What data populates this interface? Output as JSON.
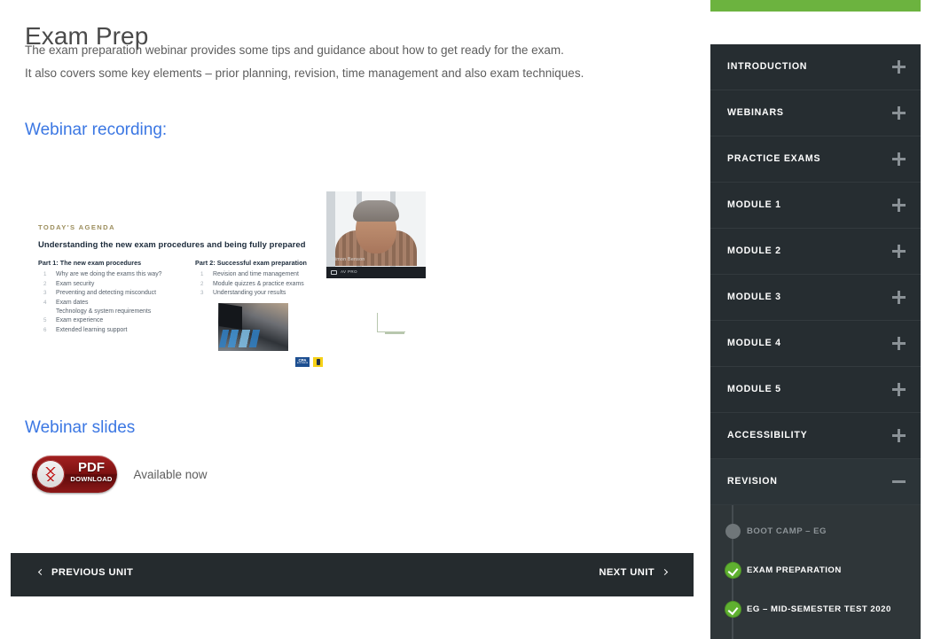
{
  "main": {
    "title": "Exam Prep",
    "paragraph_1": "The exam preparation webinar provides some tips and guidance about how to get ready for the exam.",
    "paragraph_2": "It also covers some key elements – prior planning, revision, time management and also exam techniques.",
    "section_recording": "Webinar recording:",
    "section_slides": "Webinar slides"
  },
  "slide": {
    "watermark_top_left": "",
    "watermark_bottom_right": "",
    "kicker": "TODAY'S AGENDA",
    "title": "Understanding the new exam procedures and being fully prepared",
    "part1_heading": "Part 1: The new exam procedures",
    "part1_items": [
      {
        "num": "1",
        "text": "Why are we doing the exams this way?"
      },
      {
        "num": "2",
        "text": "Exam security"
      },
      {
        "num": "3",
        "text": "Preventing and detecting misconduct"
      },
      {
        "num": "4",
        "text": "Exam dates"
      },
      {
        "num": "",
        "text": "Technology & system requirements"
      },
      {
        "num": "5",
        "text": "Exam experience"
      },
      {
        "num": "6",
        "text": "Extended learning support"
      }
    ],
    "part2_heading": "Part 2: Successful exam preparation",
    "part2_items": [
      {
        "num": "1",
        "text": "Revision and time management"
      },
      {
        "num": "2",
        "text": "Module quizzes & practice exams"
      },
      {
        "num": "3",
        "text": "Understanding your results"
      }
    ],
    "logo_primary": "CPA",
    "logo_primary_sub": "AUSTRALIA",
    "webcam_name": "Simon Benson",
    "webcam_status": "AV PRO"
  },
  "download": {
    "button_main": "PDF",
    "button_sub": "DOWNLOAD",
    "availability": "Available now"
  },
  "unit_nav": {
    "previous": "PREVIOUS UNIT",
    "next": "NEXT UNIT"
  },
  "sidebar": {
    "accent_color": "#6cb33f",
    "background_color": "#262d31",
    "items": [
      {
        "label": "INTRODUCTION",
        "state": "collapsed",
        "icon": "plus-icon"
      },
      {
        "label": "WEBINARS",
        "state": "collapsed",
        "icon": "plus-icon"
      },
      {
        "label": "PRACTICE EXAMS",
        "state": "collapsed",
        "icon": "plus-icon"
      },
      {
        "label": "MODULE 1",
        "state": "collapsed",
        "icon": "plus-icon"
      },
      {
        "label": "MODULE 2",
        "state": "collapsed",
        "icon": "plus-icon"
      },
      {
        "label": "MODULE 3",
        "state": "collapsed",
        "icon": "plus-icon"
      },
      {
        "label": "MODULE 4",
        "state": "collapsed",
        "icon": "plus-icon"
      },
      {
        "label": "MODULE 5",
        "state": "collapsed",
        "icon": "plus-icon"
      },
      {
        "label": "ACCESSIBILITY",
        "state": "collapsed",
        "icon": "plus-icon"
      },
      {
        "label": "REVISION",
        "state": "expanded",
        "icon": "minus-icon"
      }
    ],
    "sub_items": [
      {
        "label": "BOOT CAMP – EG",
        "completed": false
      },
      {
        "label": "EXAM PREPARATION",
        "completed": true
      },
      {
        "label": "EG – MID-SEMESTER TEST 2020",
        "completed": true
      }
    ]
  }
}
